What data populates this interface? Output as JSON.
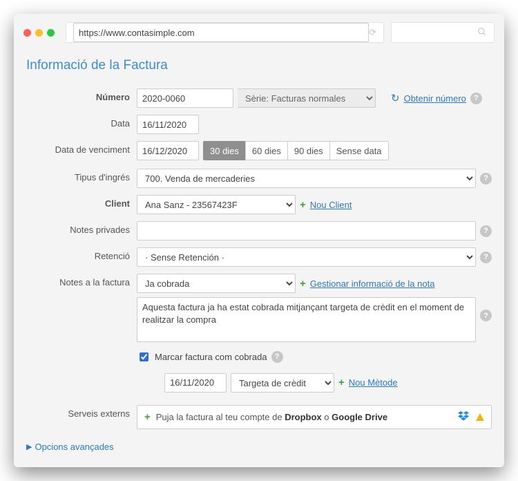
{
  "browser": {
    "url": "https://www.contasimple.com",
    "dot_colors": [
      "#ff5f57",
      "#febc2e",
      "#28c840"
    ]
  },
  "title": "Informació de la Factura",
  "labels": {
    "numero": "Número",
    "data": "Data",
    "venciment": "Data de venciment",
    "tipus": "Tipus d'ingrés",
    "client": "Client",
    "notes_priv": "Notes privades",
    "retencio": "Retenció",
    "notes_fact": "Notes a la factura",
    "serveis": "Serveis externs"
  },
  "numero": {
    "value": "2020-0060",
    "serie_option": "Sèrie: Facturas normales",
    "obtenir": "Obtenir número"
  },
  "data": {
    "value": "16/11/2020"
  },
  "venciment": {
    "value": "16/12/2020",
    "opts": {
      "d30": "30 dies",
      "d60": "60 dies",
      "d90": "90 dies",
      "none": "Sense data"
    }
  },
  "tipus": {
    "option": "700. Venda de mercaderies"
  },
  "client": {
    "option": "Ana Sanz - 23567423F",
    "nou": "Nou Client"
  },
  "retencio": {
    "option": "· Sense Retención ·"
  },
  "notes_fact": {
    "option": "Ja cobrada",
    "gestio": "Gestionar informació de la nota",
    "text": "Aquesta factura ja ha estat cobrada mitjançant targeta de crèdit en el moment de realitzar la compra"
  },
  "cobrada": {
    "check_label": "Marcar factura com cobrada",
    "date": "16/11/2020",
    "metode_option": "Targeta de crèdit",
    "nou_metode": "Nou Mètode"
  },
  "serveis": {
    "prefix": "Puja la factura al teu compte de ",
    "dropbox": "Dropbox",
    "or": " o ",
    "gdrive": "Google Drive"
  },
  "avancades": "Opcions avançades",
  "help_glyph": "?"
}
